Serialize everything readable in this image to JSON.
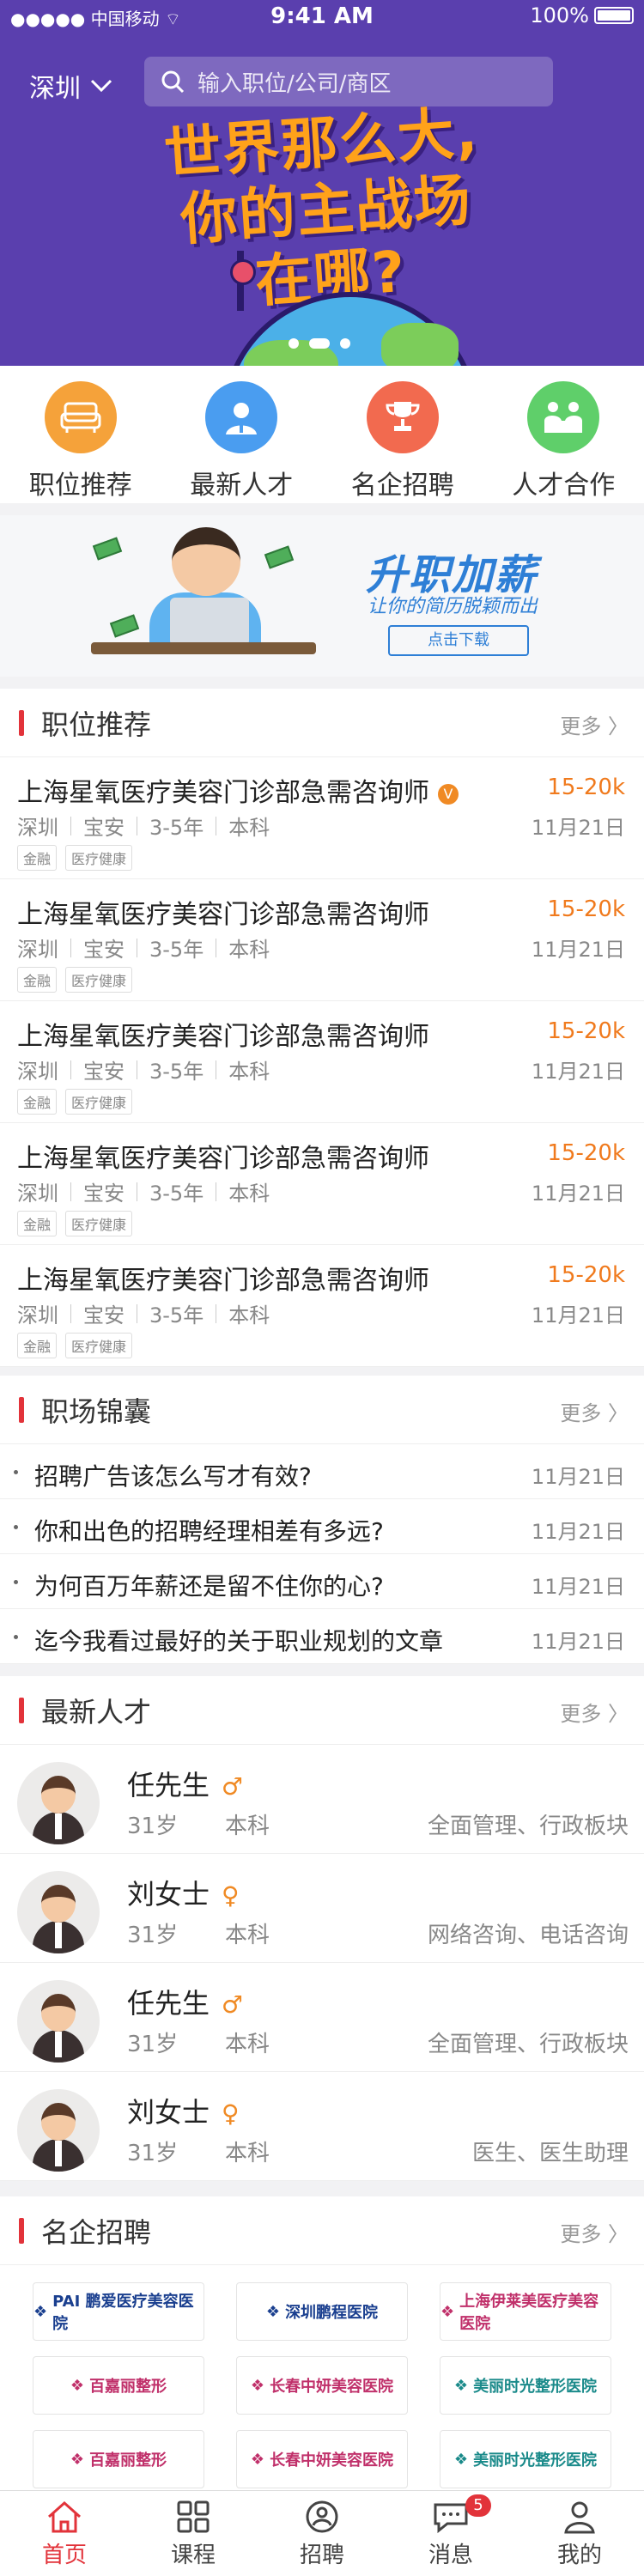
{
  "status": {
    "carrier": "中国移动",
    "time": "9:41 AM",
    "battery": "100%"
  },
  "header": {
    "city": "深圳",
    "search_placeholder": "输入职位/公司/商区"
  },
  "hero": {
    "slogan_line1": "世界那么大,",
    "slogan_line2": "你的主战场",
    "slogan_line3": "在哪?"
  },
  "categories": [
    {
      "label": "职位推荐",
      "icon": "sofa-icon",
      "color": "#f5a23a"
    },
    {
      "label": "最新人才",
      "icon": "person-icon",
      "color": "#4a9df0"
    },
    {
      "label": "名企招聘",
      "icon": "trophy-icon",
      "color": "#f26a4f"
    },
    {
      "label": "人才合作",
      "icon": "handshake-icon",
      "color": "#5fcf6a"
    }
  ],
  "banner": {
    "title": "升职加薪",
    "subtitle": "让你的简历脱颖而出",
    "button": "点击下载"
  },
  "jobs": {
    "title": "职位推荐",
    "more": "更多 〉",
    "items": [
      {
        "title": "上海星氧医疗美容门诊部急需咨询师",
        "verified": "V",
        "salary": "15-20k",
        "city": "深圳",
        "area": "宝安",
        "exp": "3-5年",
        "edu": "本科",
        "date": "11月21日",
        "tags": [
          "金融",
          "医疗健康"
        ]
      },
      {
        "title": "上海星氧医疗美容门诊部急需咨询师",
        "salary": "15-20k",
        "city": "深圳",
        "area": "宝安",
        "exp": "3-5年",
        "edu": "本科",
        "date": "11月21日",
        "tags": [
          "金融",
          "医疗健康"
        ]
      },
      {
        "title": "上海星氧医疗美容门诊部急需咨询师",
        "salary": "15-20k",
        "city": "深圳",
        "area": "宝安",
        "exp": "3-5年",
        "edu": "本科",
        "date": "11月21日",
        "tags": [
          "金融",
          "医疗健康"
        ]
      },
      {
        "title": "上海星氧医疗美容门诊部急需咨询师",
        "salary": "15-20k",
        "city": "深圳",
        "area": "宝安",
        "exp": "3-5年",
        "edu": "本科",
        "date": "11月21日",
        "tags": [
          "金融",
          "医疗健康"
        ]
      },
      {
        "title": "上海星氧医疗美容门诊部急需咨询师",
        "salary": "15-20k",
        "city": "深圳",
        "area": "宝安",
        "exp": "3-5年",
        "edu": "本科",
        "date": "11月21日",
        "tags": [
          "金融",
          "医疗健康"
        ]
      }
    ]
  },
  "articles": {
    "title": "职场锦囊",
    "more": "更多 〉",
    "items": [
      {
        "title": "招聘广告该怎么写才有效?",
        "date": "11月21日"
      },
      {
        "title": "你和出色的招聘经理相差有多远?",
        "date": "11月21日"
      },
      {
        "title": "为何百万年薪还是留不住你的心?",
        "date": "11月21日"
      },
      {
        "title": "迄今我看过最好的关于职业规划的文章",
        "date": "11月21日"
      }
    ]
  },
  "talents": {
    "title": "最新人才",
    "more": "更多 〉",
    "items": [
      {
        "name": "任先生",
        "gender": "♂",
        "age": "31岁",
        "edu": "本科",
        "skills": "全面管理、行政板块"
      },
      {
        "name": "刘女士",
        "gender": "♀",
        "age": "31岁",
        "edu": "本科",
        "skills": "网络咨询、电话咨询"
      },
      {
        "name": "任先生",
        "gender": "♂",
        "age": "31岁",
        "edu": "本科",
        "skills": "全面管理、行政板块"
      },
      {
        "name": "刘女士",
        "gender": "♀",
        "age": "31岁",
        "edu": "本科",
        "skills": "医生、医生助理"
      }
    ]
  },
  "companies": {
    "title": "名企招聘",
    "more": "更多 〉",
    "items": [
      {
        "name": "PAI 鹏爱医疗美容医院",
        "color": "#1a3f8f"
      },
      {
        "name": "深圳鹏程医院",
        "color": "#1a3f8f"
      },
      {
        "name": "上海伊莱美医疗美容医院",
        "color": "#c0306a"
      },
      {
        "name": "百嘉丽整形",
        "color": "#c0306a"
      },
      {
        "name": "长春中妍美容医院",
        "color": "#c0306a"
      },
      {
        "name": "美丽时光整形医院",
        "color": "#1a8a8a"
      },
      {
        "name": "百嘉丽整形",
        "color": "#c0306a"
      },
      {
        "name": "长春中妍美容医院",
        "color": "#c0306a"
      },
      {
        "name": "美丽时光整形医院",
        "color": "#1a8a8a"
      }
    ]
  },
  "tabbar": {
    "badge": "5",
    "items": [
      {
        "label": "首页",
        "icon": "home-icon"
      },
      {
        "label": "课程",
        "icon": "grid-icon"
      },
      {
        "label": "招聘",
        "icon": "recruit-icon"
      },
      {
        "label": "消息",
        "icon": "message-icon"
      },
      {
        "label": "我的",
        "icon": "user-icon"
      }
    ]
  }
}
